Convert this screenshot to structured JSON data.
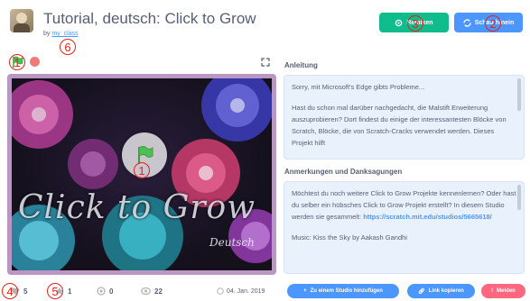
{
  "header": {
    "title": "Tutorial, deutsch: Click to Grow",
    "by_label": "by",
    "author": "my_class",
    "remix_button": "Remixen",
    "see_inside_button": "Schau hinein"
  },
  "stage": {
    "logo_main": "Click to Grow",
    "logo_sub": "Deutsch"
  },
  "stats": {
    "loves": "5",
    "favorites": "1",
    "remixes": "0",
    "views": "22",
    "date": "04. Jan. 2019"
  },
  "actions": {
    "add_to_studio": "Zu einem Studio hinzufügen",
    "copy_link": "Link kopieren",
    "report": "Melden"
  },
  "instructions": {
    "heading": "Anleitung",
    "p1": "Sorry, mit Microsoft's Edge gibts Probleme...",
    "p2": "Hast du schon mal darüber nachgedacht, die Malstift Erweiterung auszuprobieren? Dort findest du einige der interessantesten Blöcke von Scratch, Blöcke, die von Scratch-Cracks verwendet werden. Dieses Projekt hilft"
  },
  "notes": {
    "heading": "Anmerkungen und Danksagungen",
    "p1": "Möchtest du noch weitere Click to Grow Projekte kennenlernen? Oder hast du selber ein hübsches Click to Grow Projekt erstellt? In diesem Studio werden sie gesammelt:",
    "link": "https://scratch.mit.edu/studios/5665618/",
    "p2": "Music: Kiss the Sky by Aakash Gandhi"
  },
  "annotations": [
    "1",
    "1",
    "2",
    "3",
    "4",
    "5",
    "6"
  ],
  "colors": {
    "green": "#0fbd8c",
    "blue": "#4c97ff",
    "report": "#ff6680",
    "annotation": "#e8201a"
  }
}
